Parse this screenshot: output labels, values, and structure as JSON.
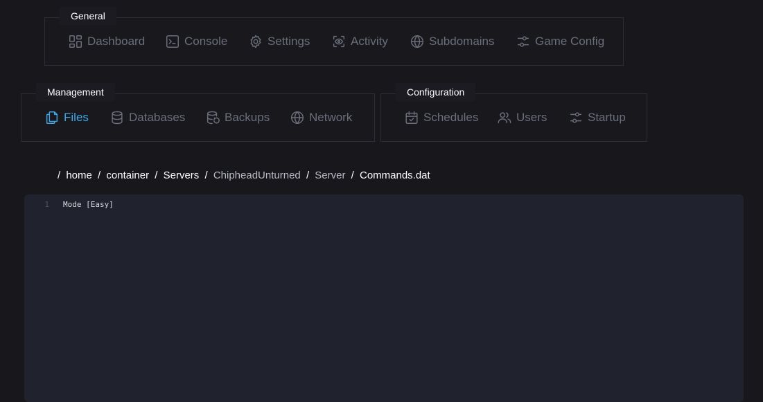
{
  "general": {
    "title": "General",
    "items": [
      {
        "label": "Dashboard",
        "icon": "dashboard-icon"
      },
      {
        "label": "Console",
        "icon": "terminal-icon"
      },
      {
        "label": "Settings",
        "icon": "gear-icon"
      },
      {
        "label": "Activity",
        "icon": "eye-scan-icon"
      },
      {
        "label": "Subdomains",
        "icon": "globe-icon"
      },
      {
        "label": "Game Config",
        "icon": "sliders-icon"
      }
    ]
  },
  "management": {
    "title": "Management",
    "items": [
      {
        "label": "Files",
        "icon": "files-icon",
        "active": true
      },
      {
        "label": "Databases",
        "icon": "database-icon"
      },
      {
        "label": "Backups",
        "icon": "database-restore-icon"
      },
      {
        "label": "Network",
        "icon": "globe-icon"
      }
    ]
  },
  "configuration": {
    "title": "Configuration",
    "items": [
      {
        "label": "Schedules",
        "icon": "calendar-check-icon"
      },
      {
        "label": "Users",
        "icon": "users-icon"
      },
      {
        "label": "Startup",
        "icon": "sliders-icon"
      }
    ]
  },
  "breadcrumb": {
    "separator": "/",
    "segments": [
      "home",
      "container",
      "Servers",
      "ChipheadUnturned",
      "Server",
      "Commands.dat"
    ]
  },
  "editor": {
    "lines": [
      {
        "number": "1",
        "text": "Mode [Easy]"
      }
    ]
  },
  "colors": {
    "background": "#17171c",
    "panel": "#18181d",
    "editor": "#20232d",
    "active": "#3ba7e8",
    "muted": "#6b6f7b"
  }
}
